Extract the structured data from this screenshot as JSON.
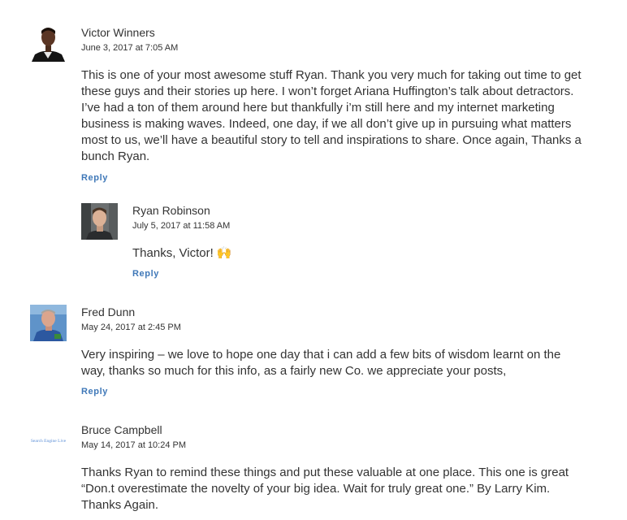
{
  "comments": [
    {
      "author": "Victor Winners",
      "date": "June 3, 2017 at 7:05 AM",
      "text": "This is one of your most awesome stuff Ryan. Thank you very much for taking out time to get these guys and their stories up here. I won’t forget Ariana Huffington’s talk about detractors. I’ve had a ton of them around here but thankfully i’m still here and my internet marketing business is making waves. Indeed, one day, if we all don’t give up in pursuing what matters most to us, we’ll have a beautiful story to tell and inspirations to share. Once again, Thanks a bunch Ryan.",
      "reply_label": "Reply"
    },
    {
      "author": "Ryan Robinson",
      "date": "July 5, 2017 at 11:58 AM",
      "text": "Thanks, Victor! 🙌",
      "reply_label": "Reply"
    },
    {
      "author": "Fred Dunn",
      "date": "May 24, 2017 at 2:45 PM",
      "text": "Very inspiring – we love to hope one day that i can add a few bits of wisdom learnt on the way, thanks so much for this info, as a fairly new Co. we appreciate your posts,",
      "reply_label": "Reply"
    },
    {
      "author": "Bruce Campbell",
      "date": "May 14, 2017 at 10:24 PM",
      "text": "Thanks Ryan to remind these things and put these valuable at one place. This one is great “Don.t overestimate the novelty of your big idea. Wait for truly great one.” By Larry Kim. Thanks Again.",
      "avatar_text": "Search Engine Live"
    }
  ],
  "colors": {
    "link": "#3f78b8",
    "text": "#333333"
  }
}
